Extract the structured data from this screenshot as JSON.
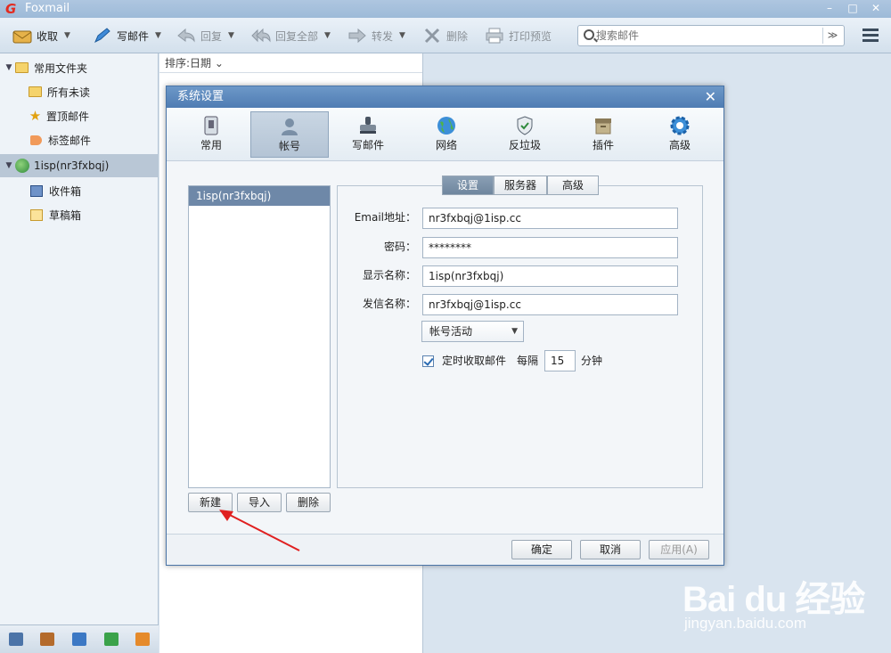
{
  "app": {
    "logo": "G",
    "title": "Foxmail",
    "win_min": "–",
    "win_max": "□",
    "win_close": "✕"
  },
  "toolbar": {
    "receive": "收取",
    "compose": "写邮件",
    "reply": "回复",
    "reply_all": "回复全部",
    "forward": "转发",
    "delete": "删除",
    "print_preview": "打印预览",
    "search_placeholder": "搜索邮件",
    "search_drop": "≫"
  },
  "sidebar": {
    "common_folder": "常用文件夹",
    "all_unread": "所有未读",
    "pinned": "置顶邮件",
    "tagged": "标签邮件",
    "account": "1isp(nr3fxbqj)",
    "inbox": "收件箱",
    "drafts": "草稿箱"
  },
  "maillist": {
    "sort_label": "排序:日期",
    "sort_caret": "⌄"
  },
  "dialog": {
    "title": "系统设置",
    "close": "✕",
    "tabs": [
      "常用",
      "帐号",
      "写邮件",
      "网络",
      "反垃圾",
      "插件",
      "高级"
    ],
    "account_list": [
      "1isp(nr3fxbqj)"
    ],
    "buttons": {
      "new": "新建",
      "import": "导入",
      "delete": "删除"
    },
    "segments": {
      "settings": "设置",
      "server": "服务器",
      "advanced": "高级"
    },
    "fields": {
      "email_label": "Email地址：",
      "email_value": "nr3fxbqj@1isp.cc",
      "password_label": "密码：",
      "password_value": "********",
      "display_label": "显示名称：",
      "display_value": "1isp(nr3fxbqj)",
      "sender_label": "发信名称：",
      "sender_value": "nr3fxbqj@1isp.cc"
    },
    "account_status": "帐号活动",
    "timer": {
      "label": "定时收取邮件",
      "every": "每隔",
      "value": "15",
      "unit": "分钟",
      "checked": true
    },
    "footer": {
      "ok": "确定",
      "cancel": "取消",
      "apply": "应用(A)"
    }
  },
  "watermark": {
    "brand": "Bai du 经验",
    "url": "jingyan.baidu.com"
  },
  "colors": {
    "accent": "#4f7cb3",
    "selected_row": "#6e88a8",
    "annotation": "#e02020"
  }
}
